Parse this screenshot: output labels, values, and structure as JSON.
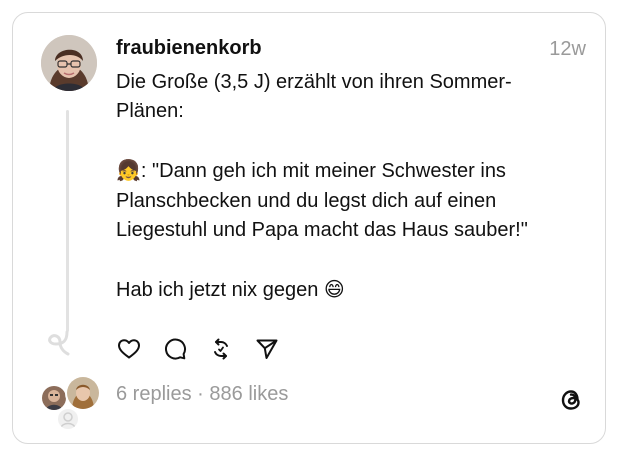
{
  "post": {
    "username": "fraubienenkorb",
    "time": "12w",
    "lines": {
      "intro1": "Die Große (3,5 J) erzählt von ihren Sommer-",
      "intro2": "Plänen:",
      "quote_prefix": ": \"Dann geh ich mit meiner Schwester ins",
      "quote2": "Planschbecken und du legst dich auf einen",
      "quote3": "Liegestuhl und Papa macht das Haus sauber!\"",
      "closing": "Hab ich jetzt nix gegen "
    },
    "emojis": {
      "girl": "👧",
      "grin": "😄"
    }
  },
  "footer": {
    "replies_label": "6 replies",
    "separator": " · ",
    "likes_label": "886 likes"
  },
  "icons": {
    "like": "heart-icon",
    "reply": "comment-icon",
    "repost": "repost-icon",
    "share": "send-icon",
    "logo": "threads-logo-icon"
  },
  "colors": {
    "text": "#111111",
    "muted": "#9a9a9a",
    "border": "#d9d9d9"
  }
}
